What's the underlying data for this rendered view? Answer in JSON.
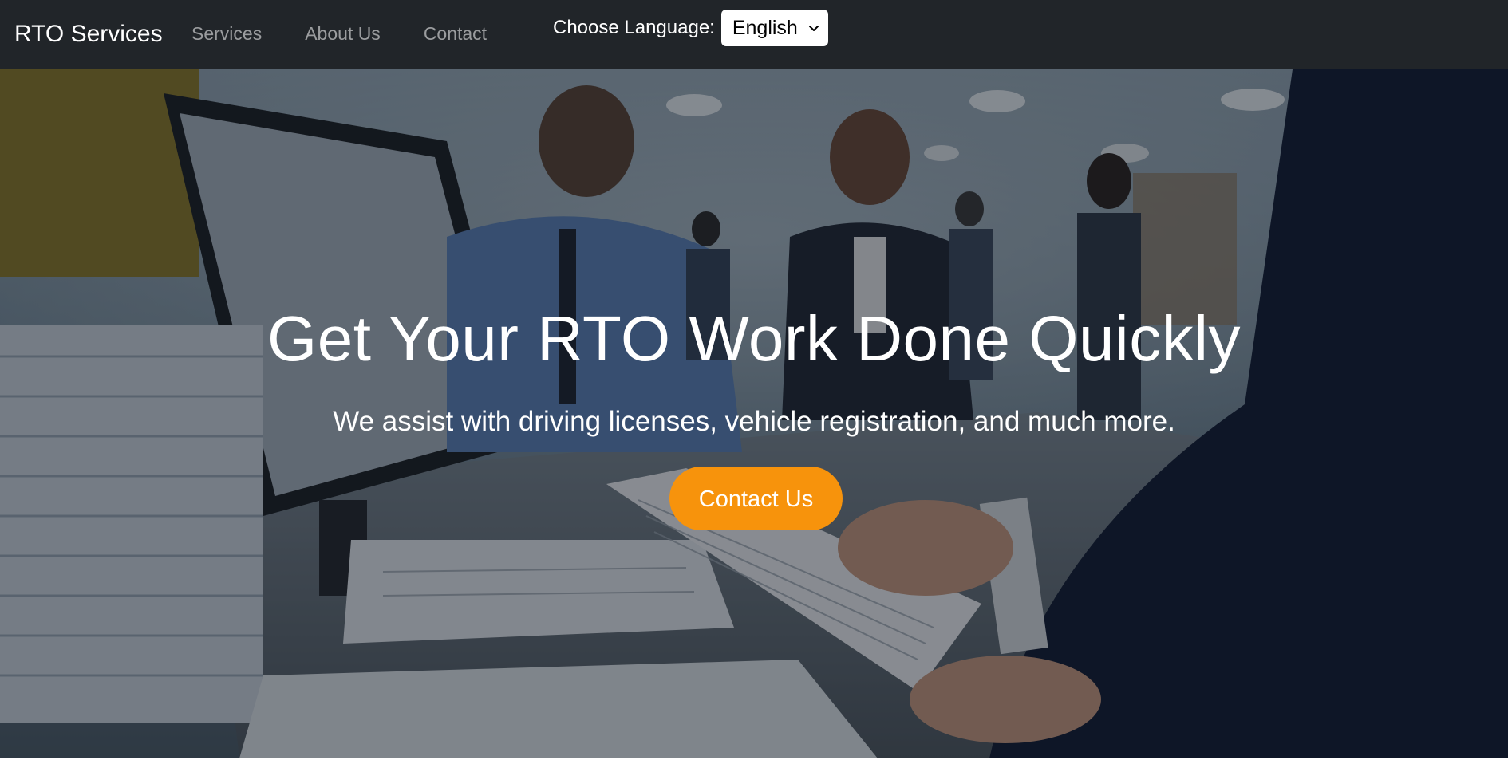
{
  "navbar": {
    "brand": "RTO Services",
    "links": [
      "Services",
      "About Us",
      "Contact"
    ],
    "language_label": "Choose Language:",
    "language_selected": "English",
    "background_color": "#212529"
  },
  "hero": {
    "title": "Get Your RTO Work Done Quickly",
    "subtitle": "We assist with driving licenses, vehicle registration, and much more.",
    "cta_label": "Contact Us",
    "cta_color": "#f7930c"
  },
  "icons": {
    "language_dropdown": "chevron-down-icon"
  }
}
